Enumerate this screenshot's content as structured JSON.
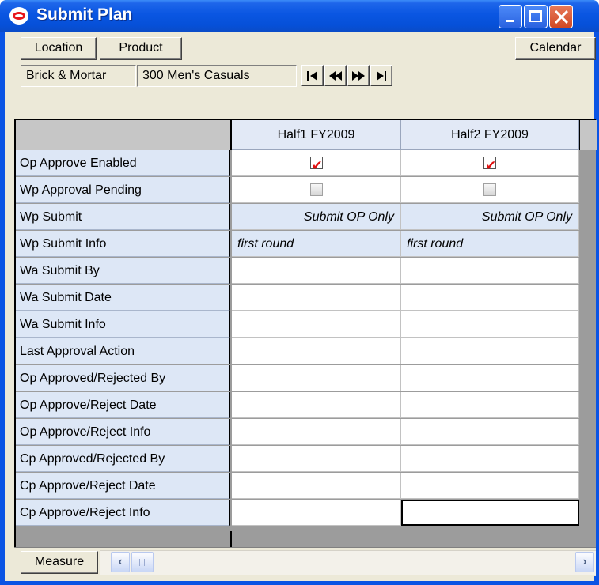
{
  "window": {
    "title": "Submit Plan"
  },
  "toolbar": {
    "location": "Location",
    "product": "Product",
    "calendar": "Calendar"
  },
  "breadcrumb": {
    "channel": "Brick & Mortar",
    "department": "300 Men's Casuals"
  },
  "columns": [
    "Half1 FY2009",
    "Half2 FY2009"
  ],
  "rows": [
    {
      "label": "Op Approve Enabled",
      "type": "checkbox",
      "values": [
        true,
        true
      ]
    },
    {
      "label": "Wp Approval Pending",
      "type": "checkbox",
      "values": [
        false,
        false
      ]
    },
    {
      "label": "Wp Submit",
      "type": "text",
      "values": [
        "Submit OP Only",
        "Submit OP Only"
      ]
    },
    {
      "label": "Wp Submit Info",
      "type": "text",
      "values": [
        "first round",
        "first round"
      ]
    },
    {
      "label": "Wa Submit By",
      "type": "text",
      "values": [
        "",
        ""
      ]
    },
    {
      "label": "Wa Submit Date",
      "type": "text",
      "values": [
        "",
        ""
      ]
    },
    {
      "label": "Wa Submit Info",
      "type": "text",
      "values": [
        "",
        ""
      ]
    },
    {
      "label": "Last Approval Action",
      "type": "text",
      "values": [
        "",
        ""
      ]
    },
    {
      "label": "Op Approved/Rejected By",
      "type": "text",
      "values": [
        "",
        ""
      ]
    },
    {
      "label": "Op Approve/Reject Date",
      "type": "text",
      "values": [
        "",
        ""
      ]
    },
    {
      "label": "Op Approve/Reject Info",
      "type": "text",
      "values": [
        "",
        ""
      ]
    },
    {
      "label": "Cp Approved/Rejected By",
      "type": "text",
      "values": [
        "",
        ""
      ]
    },
    {
      "label": "Cp Approve/Reject Date",
      "type": "text",
      "values": [
        "",
        ""
      ]
    },
    {
      "label": "Cp Approve/Reject Info",
      "type": "text",
      "values": [
        "",
        ""
      ]
    }
  ],
  "footer": {
    "measure": "Measure"
  },
  "icons": {
    "nav": [
      "first-icon",
      "previous-icon",
      "next-icon",
      "last-icon"
    ]
  },
  "colors": {
    "title_bar": "#0a54e4",
    "header_bg": "#e2e9f6",
    "row_label_bg": "#dde7f6",
    "check_mark": "#e01010"
  }
}
